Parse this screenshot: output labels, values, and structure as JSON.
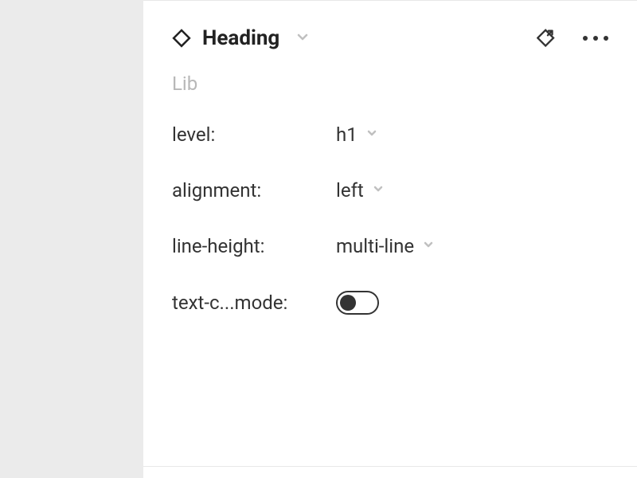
{
  "header": {
    "title": "Heading"
  },
  "section": {
    "label": "Lib"
  },
  "props": {
    "level": {
      "label": "level:",
      "value": "h1"
    },
    "alignment": {
      "label": "alignment:",
      "value": "left"
    },
    "lineHeight": {
      "label": "line-height:",
      "value": "multi-line"
    },
    "textMode": {
      "label": "text-c...mode:",
      "value": false
    }
  }
}
